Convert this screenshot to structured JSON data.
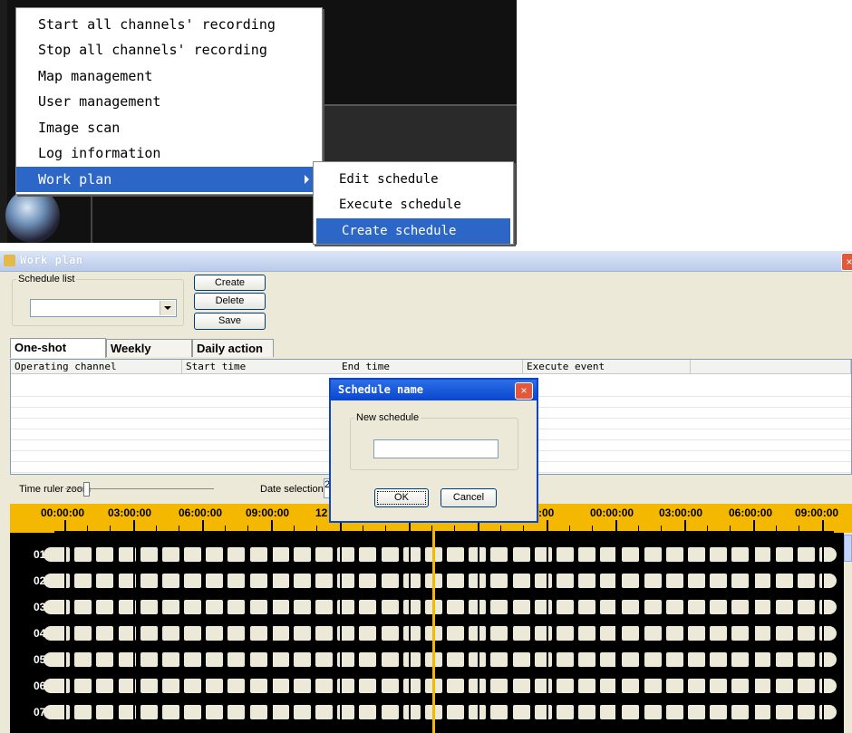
{
  "context_menu": {
    "items": [
      {
        "label": "Start all channels' recording"
      },
      {
        "label": "Stop all channels' recording"
      },
      {
        "label": "Map management"
      },
      {
        "label": "User management"
      },
      {
        "label": "Image scan"
      },
      {
        "label": "Log information"
      },
      {
        "label": "Work plan"
      }
    ],
    "submenu": [
      {
        "label": "Edit schedule"
      },
      {
        "label": "Execute schedule"
      },
      {
        "label": "Create schedule"
      }
    ],
    "highlight_color": "#2c66c7"
  },
  "window": {
    "title": "Work plan",
    "close_glyph": "×",
    "schedule_list": {
      "legend": "Schedule list",
      "value": ""
    },
    "buttons": {
      "create": "Create",
      "delete": "Delete",
      "save": "Save"
    },
    "tabs": [
      {
        "label": "One-shot action",
        "active": true
      },
      {
        "label": "Weekly action",
        "active": false
      },
      {
        "label": "Daily action",
        "active": false
      }
    ],
    "columns": [
      "Operating channel",
      "Start time",
      "End time",
      "Execute event"
    ],
    "time_ruler_zoom_label": "Time ruler zoom",
    "date_selection_label": "Date selection",
    "date_value": "2"
  },
  "timeline": {
    "ticks": [
      "00:00:00",
      "03:00:00",
      "06:00:00",
      "09:00:00",
      "12",
      "",
      "",
      "",
      ":00",
      "00:00:00",
      "03:00:00",
      "06:00:00",
      "09:00:00"
    ],
    "channels": [
      "01",
      "02",
      "03",
      "04",
      "05",
      "06",
      "07"
    ],
    "ruler_color": "#f5b800"
  },
  "dialog": {
    "title": "Schedule name",
    "group_label": "New schedule",
    "input_value": "",
    "ok_label": "OK",
    "cancel_label": "Cancel",
    "close_glyph": "×",
    "titlebar_color": "#0a46cf"
  }
}
